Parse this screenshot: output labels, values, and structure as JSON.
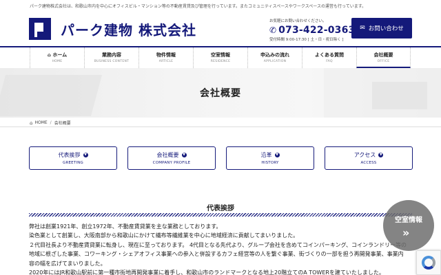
{
  "topbar": {
    "text": "パーク建物株式会社は、和歌山市内を中心にオフィスビル・マンション等の不動産賃貸及び管理を行っています。またコミュニティスペースやワークスペースの運営も行っています。"
  },
  "header": {
    "logo_text": "パーク建物 株式会社",
    "contact_label": "お気軽にお問い合わせください。",
    "tel": "073-422-0363",
    "hours": "受付時間 9:00-17:30 [ 土・日・祝日除く ]",
    "contact_button": "お問い合わせ"
  },
  "nav": [
    {
      "jp": "ホーム",
      "en": "HOME"
    },
    {
      "jp": "業務内容",
      "en": "BUSINESS CONTENT"
    },
    {
      "jp": "物件情報",
      "en": "ARTICLE"
    },
    {
      "jp": "空室情報",
      "en": "RESIDENCE"
    },
    {
      "jp": "申込みの流れ",
      "en": "APPLICATION"
    },
    {
      "jp": "よくある質問",
      "en": "FAQ"
    },
    {
      "jp": "会社概要",
      "en": "OFFICE"
    }
  ],
  "hero": {
    "title": "会社概要"
  },
  "breadcrumb": {
    "home": "HOME",
    "current": "会社概要"
  },
  "tabs": [
    {
      "jp": "代表挨拶",
      "en": "GREETING"
    },
    {
      "jp": "会社概要",
      "en": "COMPANY PROFILE"
    },
    {
      "jp": "沿革",
      "en": "HISTORY"
    },
    {
      "jp": "アクセス",
      "en": "ACCESS"
    }
  ],
  "section": {
    "title": "代表挨拶",
    "paragraphs": [
      "弊社は創業1921年、創立1972年、不動産賃貸業を主な業務としております。",
      "染色業として創業し、大阪南部から和歌山にかけて繊布等繊維業を中心に地域経済に貢献してまいりました。",
      "２代目社長より不動産賃貸業に転身し、現在に至っております。 4代目となる先代より、グループ会社を含めてコインパーキング、コインランドリー等の",
      "地域に根ざした事業、コワーキング・シェアオフィス事業への参入と併設するカフェ経営等の人を繋ぐ事業、街づくりの一部を担う再開発事業、事業内",
      "容の幅を広げてまいりました。",
      "2020年にはJR和歌山駅前に第一種市街地再開発事業に着手し、和歌山市のランドマークとなる地上20階立てのA TOWERを建ていたしました。"
    ]
  },
  "float_badge": {
    "label": "空室情報"
  }
}
